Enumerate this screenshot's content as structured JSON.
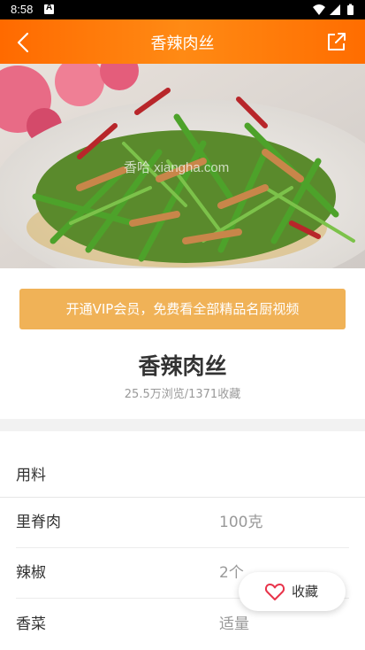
{
  "status_bar": {
    "time": "8:58",
    "notification_icon": "a-badge-icon",
    "icons": [
      "wifi-icon",
      "signal-icon",
      "battery-icon"
    ]
  },
  "app_bar": {
    "title": "香辣肉丝",
    "back_icon": "chevron-left-icon",
    "share_icon": "share-icon",
    "colors": {
      "from": "#ff6a00",
      "to": "#ff8a14"
    }
  },
  "hero": {
    "watermark": "香哈 xiangha.com"
  },
  "vip_banner": {
    "text": "开通VIP会员，免费看全部精品名厨视频",
    "color": "#f0b257"
  },
  "recipe": {
    "title": "香辣肉丝",
    "stats": "25.5万浏览/1371收藏"
  },
  "ingredients": {
    "heading": "用料",
    "items": [
      {
        "name": "里脊肉",
        "amount": "100克"
      },
      {
        "name": "辣椒",
        "amount": "2个"
      },
      {
        "name": "香菜",
        "amount": "适量"
      }
    ]
  },
  "favorite": {
    "label": "收藏",
    "icon": "heart-icon",
    "color": "#e8334a"
  }
}
